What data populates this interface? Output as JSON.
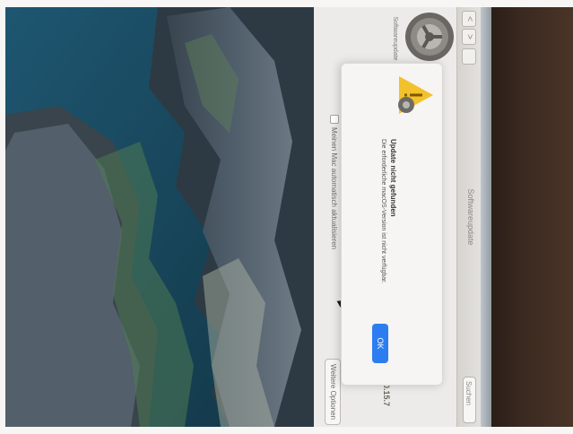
{
  "window": {
    "title": "Softwareupdate",
    "nav_back": "<",
    "nav_forward": ">",
    "search_placeholder": "Suchen",
    "pane_label": "Softwareupdate",
    "auto_update_label": "Meinen Mac automatisch aktualisieren",
    "auto_update_checked": false,
    "more_options_label": "Weitere Optionen",
    "version_text": "0.15.7"
  },
  "alert": {
    "icon": "caution-icon",
    "title": "Update nicht gefunden",
    "message": "Die erforderliche macOS-Version ist nicht verfügbar.",
    "ok_label": "OK"
  },
  "colors": {
    "accent": "#2c7ef0",
    "caution": "#f3c12c"
  }
}
